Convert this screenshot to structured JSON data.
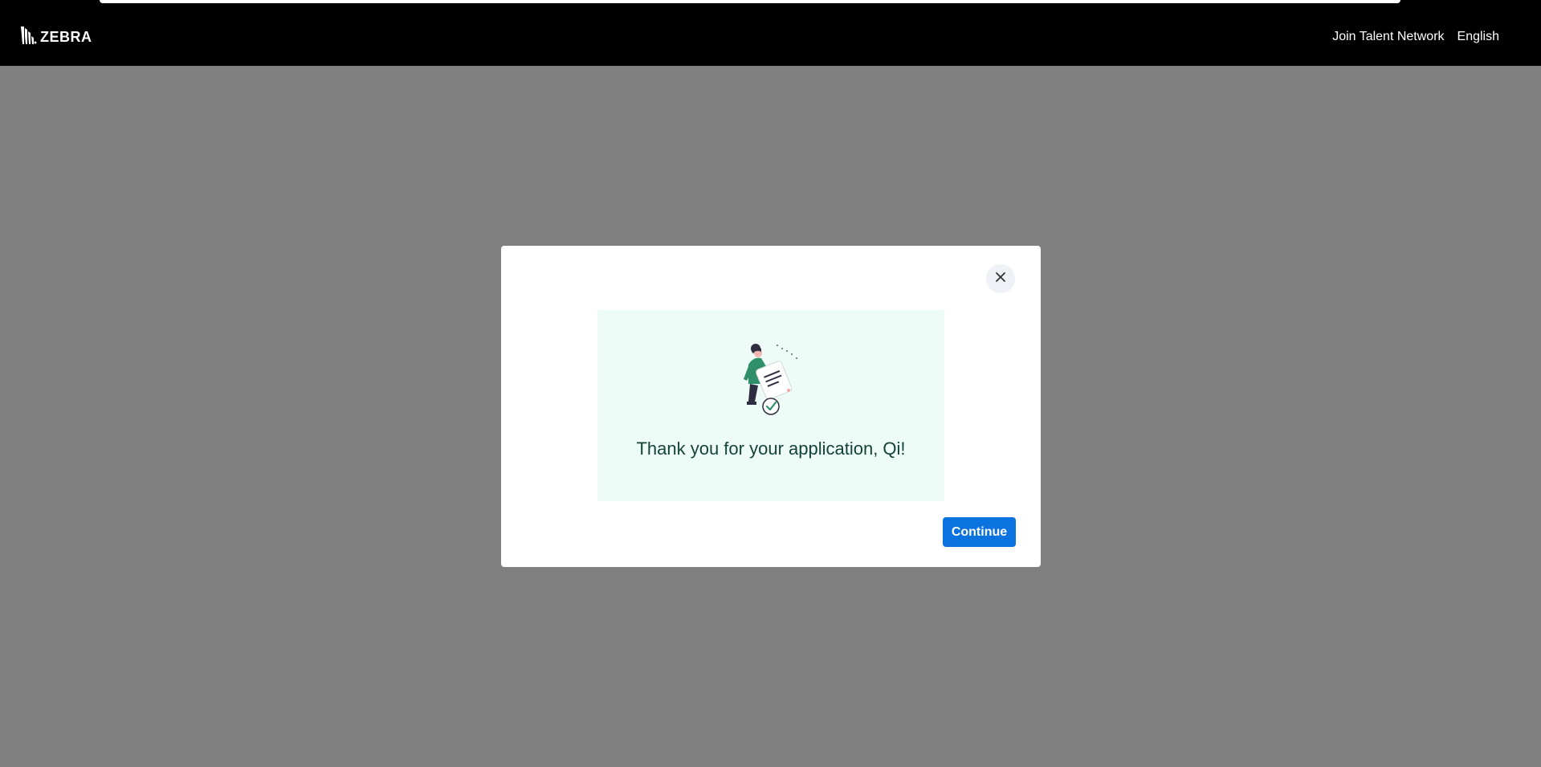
{
  "header": {
    "logo_text": "ZEBRA",
    "nav": {
      "join_talent_network": "Join Talent Network",
      "language": "English"
    }
  },
  "modal": {
    "close_icon": "close-icon",
    "illustration_icon": "woman-holding-document-check-illustration",
    "thanks_message": "Thank you for your application, Qi!",
    "continue_label": "Continue"
  },
  "colors": {
    "header_bg": "#000000",
    "overlay_bg": "#808080",
    "banner_bg": "#edfcf6",
    "message_text": "#15433a",
    "primary_button": "#0b73e0"
  }
}
